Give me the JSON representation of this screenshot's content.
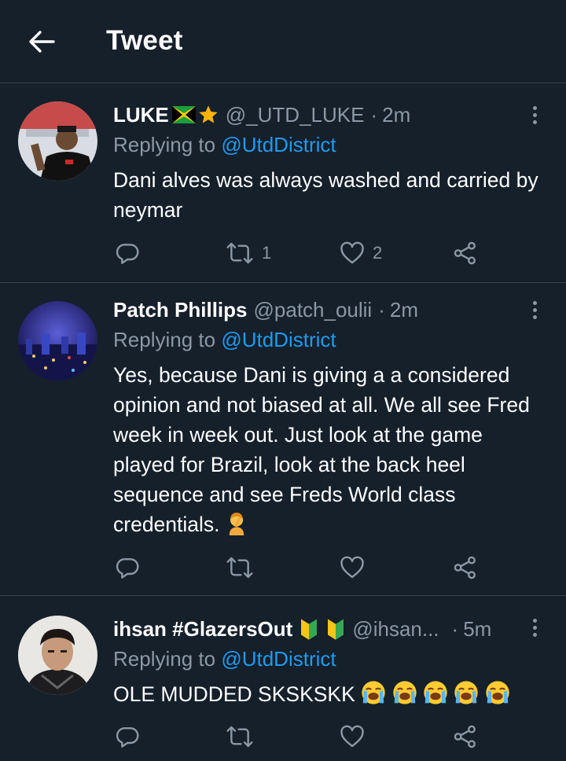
{
  "header": {
    "title": "Tweet"
  },
  "colors": {
    "background": "#15202b",
    "divider": "#38444d",
    "muted": "#8b98a5",
    "link": "#1d9bf0"
  },
  "tweets": [
    {
      "name": "LUKE",
      "name_badges": [
        "jamaica-flag-emoji",
        "star-emoji"
      ],
      "handle": "@_UTD_LUKE",
      "dot": "·",
      "time": "2m",
      "replying_prefix": "Replying to ",
      "replying_to": "@UtdDistrict",
      "text": "Dani alves was always washed and carried by neymar",
      "reply_count": "",
      "retweet_count": "1",
      "like_count": "2"
    },
    {
      "name": "Patch Phillips",
      "handle": "@patch_oulii",
      "dot": "·",
      "time": "2m",
      "replying_prefix": "Replying to ",
      "replying_to": "@UtdDistrict",
      "text": "Yes, because Dani is giving a a considered opinion and not biased at all. We all see Fred week in week out. Just look at the game played for Brazil, look at the back heel sequence and see Freds World class credentials.",
      "text_trailing_emoji": "person-facepalming-emoji",
      "reply_count": "",
      "retweet_count": "",
      "like_count": ""
    },
    {
      "name": "ihsan #GlazersOut",
      "name_badges": [
        "beginner-badge-emoji",
        "beginner-badge-emoji"
      ],
      "handle": "@ihsan...",
      "dot": "·",
      "time": "5m",
      "replying_prefix": "Replying to ",
      "replying_to": "@UtdDistrict",
      "text": "OLE MUDDED SKSKSKK",
      "text_trailing_emoji": "loudly-crying-face-emoji x5",
      "reply_count": "",
      "retweet_count": "",
      "like_count": ""
    }
  ]
}
